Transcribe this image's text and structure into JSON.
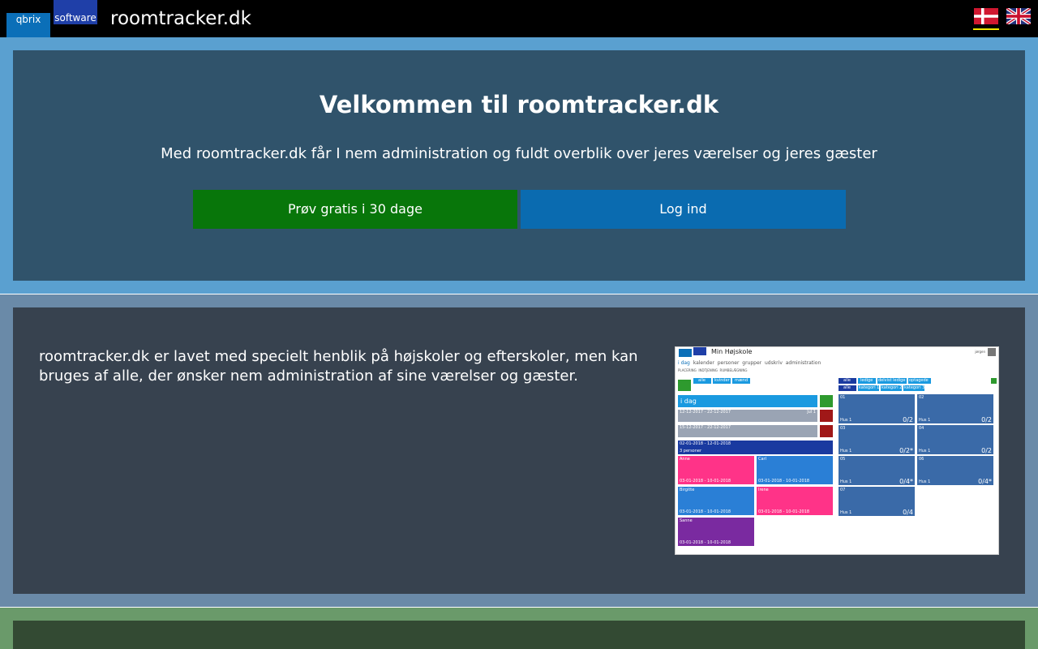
{
  "header": {
    "logo_left": "qbrix",
    "logo_right": "software",
    "site_title": "roomtracker.dk"
  },
  "hero": {
    "title": "Velkommen til roomtracker.dk",
    "subtitle": "Med roomtracker.dk får I nem administration og fuldt overblik over jeres værelser og jeres gæster",
    "trial_button": "Prøv gratis i 30 dage",
    "login_button": "Log ind"
  },
  "info": {
    "text": "roomtracker.dk er lavet med specielt henblik på højskoler og efterskoler, men kan bruges af alle, der ønsker nem administration af sine værelser og gæster."
  },
  "screenshot": {
    "app_title": "Min Højskole",
    "user": "jørgen",
    "nav": [
      "i dag",
      "kalender",
      "personer",
      "grupper",
      "udskriv",
      "administration"
    ],
    "subnav": [
      "PLACERING",
      "INDTJENING",
      "RUMBELÆGNING"
    ],
    "filters_left": [
      "alle",
      "kvinder",
      "mænd"
    ],
    "filters_right_top": [
      "alle",
      "ledige",
      "delvist ledige",
      "optagede"
    ],
    "filters_right_bottom": [
      "alle",
      "kategori 1",
      "kategori 2",
      "kategori 3"
    ],
    "today_label": "i dag",
    "rows": [
      {
        "dates": "12-12-2017 - 22-12-2017",
        "tag": "Jul 1"
      },
      {
        "dates": "15-12-2017 - 22-12-2017",
        "tag": ""
      },
      {
        "dates": "02-01-2018 - 12-01-2018",
        "tag": "3 personer"
      }
    ],
    "guests": [
      {
        "name": "Anne",
        "dates": "03-01-2018 - 10-01-2018",
        "color": "#ff3388"
      },
      {
        "name": "Carl",
        "dates": "03-01-2018 - 10-01-2018",
        "color": "#2a7fd6"
      },
      {
        "name": "Birgitte",
        "dates": "03-01-2018 - 10-01-2018",
        "color": "#2a7fd6"
      },
      {
        "name": "Irene",
        "dates": "03-01-2018 - 10-01-2018",
        "color": "#ff3388"
      },
      {
        "name": "Sanne",
        "dates": "03-01-2018 - 10-01-2018",
        "color": "#7a2aa0"
      }
    ],
    "rooms": [
      {
        "name": "01",
        "cap": "0/2",
        "note": "Hus 1"
      },
      {
        "name": "02",
        "cap": "0/2",
        "note": "Hus 1"
      },
      {
        "name": "03",
        "cap": "0/2*",
        "note": "Hus 1"
      },
      {
        "name": "04",
        "cap": "0/2",
        "note": "Hus 1"
      },
      {
        "name": "05",
        "cap": "0/4*",
        "note": "Hus 1"
      },
      {
        "name": "06",
        "cap": "0/4*",
        "note": "Hus 1"
      },
      {
        "name": "07",
        "cap": "0/4",
        "note": "Hus 1"
      }
    ]
  },
  "colors": {
    "header_bg": "#000000",
    "band1": "#5aa0d0",
    "panel1": "#30536b",
    "band2": "#6a8aa8",
    "panel2": "#37424f",
    "band3": "#6a9a6a",
    "panel3": "#334a33",
    "trial_button": "#08760a",
    "login_button": "#0a6bb0",
    "flag_underline": "#f2e600"
  }
}
